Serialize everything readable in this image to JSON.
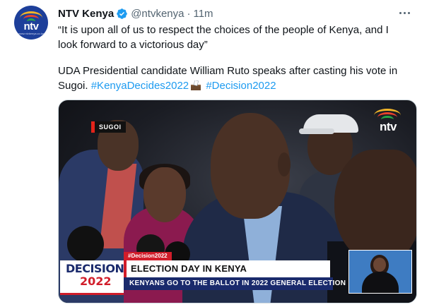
{
  "account": {
    "name": "NTV Kenya",
    "handle": "@ntvkenya",
    "separator": "·",
    "time": "11m",
    "avatar_logo": "ntv",
    "avatar_sub": "www.ntvkenya.co.ke"
  },
  "tweet": {
    "quote": "“It is upon all of us to respect the choices of the people of Kenya, and I look forward to a victorious day”",
    "text": "UDA Presidential candidate William Ruto speaks after casting his vote in Sugoi.",
    "hashtag1": "#KenyaDecides2022",
    "hashtag2": "#Decision2022"
  },
  "media": {
    "location_tag": "SUGOI",
    "bug_logo": "ntv",
    "decision_word": "DECISION",
    "decision_year": "2022",
    "hashtag_strap": "#Decision2022",
    "headline": "ELECTION DAY IN KENYA",
    "subheadline": "KENYANS GO TO THE BALLOT IN 2022 GENERAL ELECTION"
  },
  "icons": {
    "verified": "verified-badge-icon",
    "more": "more-options-icon",
    "ballot": "ballot-box-icon"
  },
  "colors": {
    "link": "#1d9bf0",
    "verified": "#1d9bf0",
    "muted": "#536471",
    "brand_red": "#d11d2a",
    "brand_navy": "#1a2a6c"
  }
}
